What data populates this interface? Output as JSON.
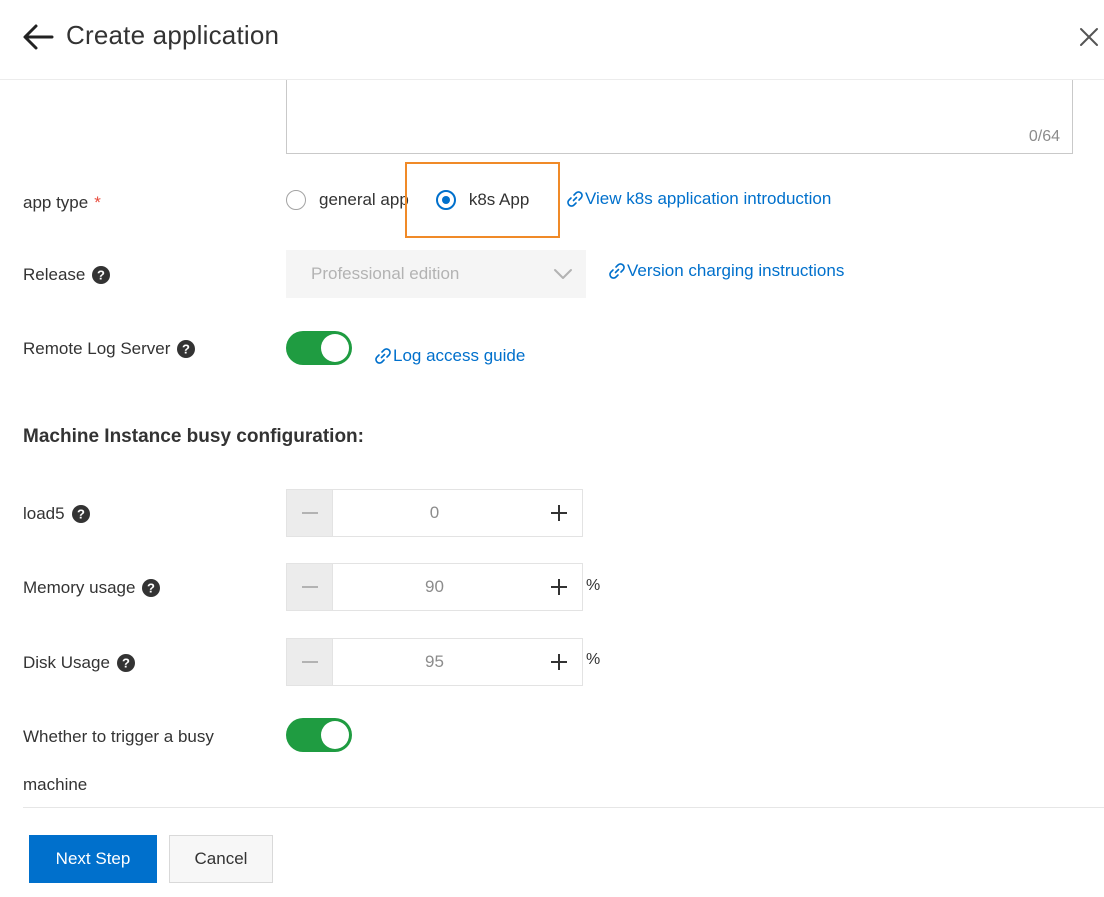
{
  "header": {
    "title": "Create application"
  },
  "description_field": {
    "char_count": "0/64"
  },
  "app_type": {
    "label": "app type",
    "required_mark": "*",
    "options": [
      {
        "label": "general app",
        "selected": false
      },
      {
        "label": "k8s App",
        "selected": true
      }
    ],
    "intro_link": "View k8s application introduction"
  },
  "release": {
    "label": "Release",
    "value": "Professional edition",
    "link": "Version charging instructions"
  },
  "remote_log": {
    "label": "Remote Log Server",
    "enabled": true,
    "link": "Log access guide"
  },
  "busy_config": {
    "title": "Machine Instance busy configuration:",
    "fields": [
      {
        "label": "load5",
        "value": "0",
        "suffix": ""
      },
      {
        "label": "Memory usage",
        "value": "90",
        "suffix": "%"
      },
      {
        "label": "Disk Usage",
        "value": "95",
        "suffix": "%"
      }
    ],
    "trigger": {
      "label_line1": "Whether to trigger a busy",
      "label_line2": "machine",
      "enabled": true
    }
  },
  "footer": {
    "next_label": "Next Step",
    "cancel_label": "Cancel"
  },
  "colors": {
    "primary": "#0070cc",
    "toggle_on": "#1f9c41",
    "highlight": "#f08a28",
    "required": "#e84b3c"
  },
  "icons": [
    "back-arrow-icon",
    "close-icon",
    "help-icon",
    "link-icon",
    "chevron-down-icon",
    "minus-icon",
    "plus-icon"
  ]
}
